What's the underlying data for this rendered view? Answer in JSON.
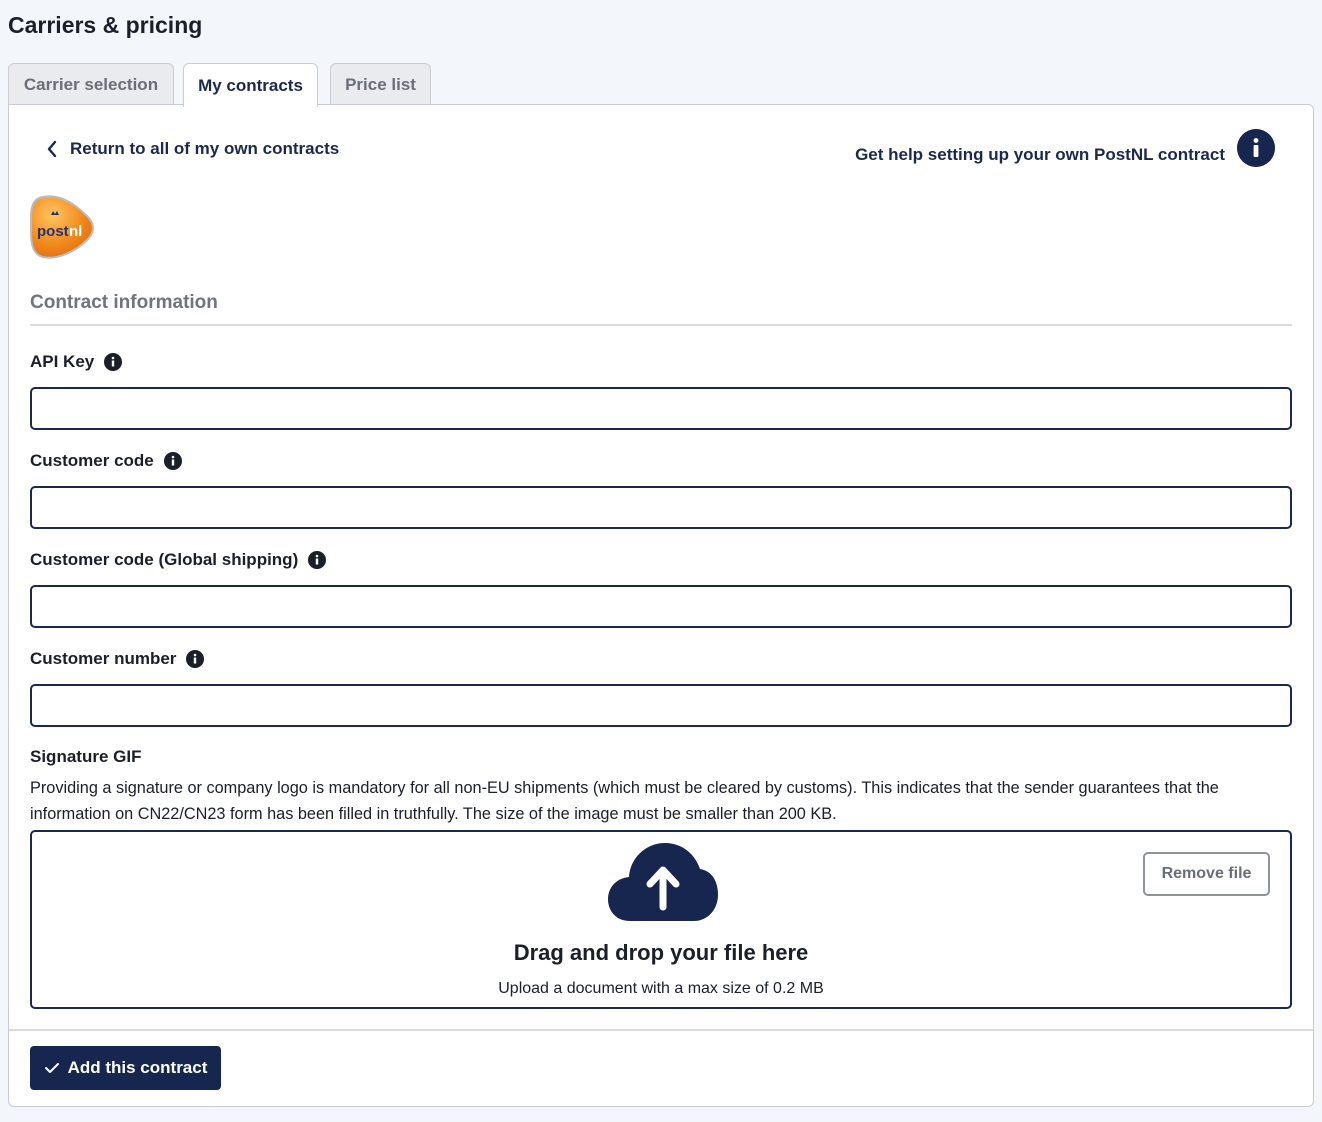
{
  "page": {
    "title": "Carriers & pricing"
  },
  "tabs": [
    {
      "label": "Carrier selection",
      "active": false
    },
    {
      "label": "My contracts",
      "active": true
    },
    {
      "label": "Price list",
      "active": false
    }
  ],
  "header": {
    "back_link": "Return to all of my own contracts",
    "help_link": "Get help setting up your own PostNL contract"
  },
  "logo": {
    "text_post": "post",
    "text_nl": "nl",
    "brand_color": "#f18a1f"
  },
  "form": {
    "section_title": "Contract information",
    "fields": [
      {
        "label": "API Key",
        "value": "",
        "placeholder": ""
      },
      {
        "label": "Customer code",
        "value": "",
        "placeholder": ""
      },
      {
        "label": "Customer code (Global shipping)",
        "value": "",
        "placeholder": ""
      },
      {
        "label": "Customer number",
        "value": "",
        "placeholder": ""
      }
    ],
    "signature": {
      "title": "Signature GIF",
      "description": "Providing a signature or company logo is mandatory for all non-EU shipments (which must be cleared by customs). This indicates that the sender guarantees that the information on CN22/CN23 form has been filled in truthfully. The size of the image must be smaller than 200 KB.",
      "dropzone_title": "Drag and drop your file here",
      "dropzone_subtitle": "Upload a document with a max size of 0.2 MB",
      "remove_label": "Remove file",
      "icon": "cloud-upload-icon"
    }
  },
  "actions": {
    "submit_label": "Add this contract"
  },
  "colors": {
    "primary": "#16264f",
    "page_bg": "#f3f6fb",
    "border": "#c9ccd3"
  }
}
